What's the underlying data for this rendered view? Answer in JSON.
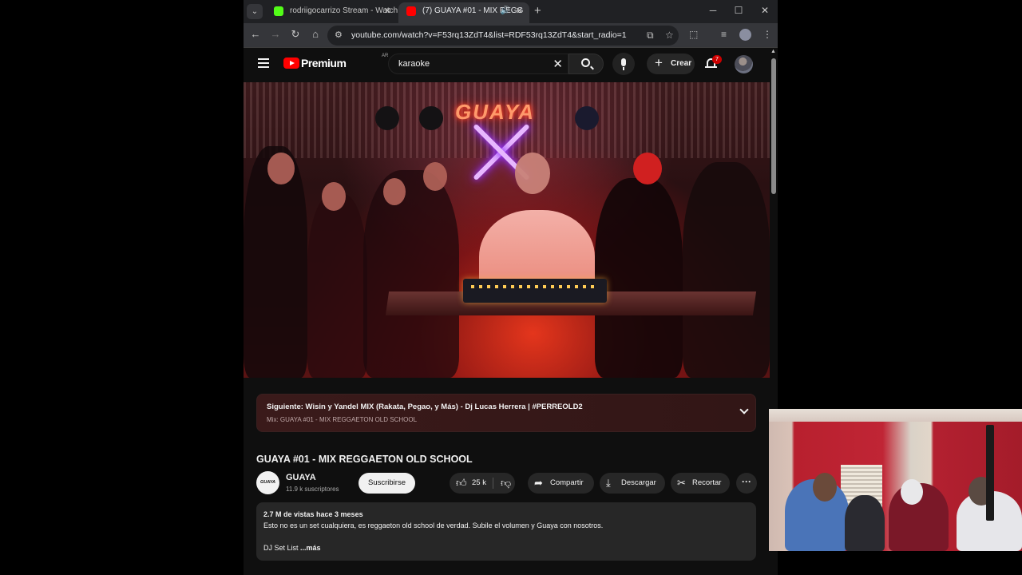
{
  "browser": {
    "tabs": [
      {
        "title": "rodriigocarrizo Stream - Watch",
        "favicon_color": "#53fc18",
        "active": false
      },
      {
        "title": "(7) GUAYA #01 - MIX REGG",
        "favicon_color": "#ff0000",
        "active": true
      }
    ],
    "url": "youtube.com/watch?v=F53rq13ZdT4&list=RDF53rq13ZdT4&start_radio=1"
  },
  "youtube": {
    "logo_text": "Premium",
    "country_code": "AR",
    "search_query": "karaoke",
    "create_label": "Crear",
    "notification_count": "7"
  },
  "upnext": {
    "label": "Siguiente: Wisin y Yandel MIX (Rakata, Pegao, y Más) - Dj Lucas Herrera | #PERREOLD2",
    "mix": "Mix: GUAYA #01 - MIX REGGAETON OLD SCHOOL"
  },
  "video": {
    "neon_sign": "GUAYA",
    "title": "GUAYA #01 - MIX REGGAETON OLD SCHOOL",
    "channel": "GUAYA",
    "channel_avatar_text": "GUAYA",
    "subscribers": "11.9 k suscriptores",
    "subscribe_label": "Suscribirse",
    "likes": "25 k",
    "share_label": "Compartir",
    "download_label": "Descargar",
    "clip_label": "Recortar",
    "views_and_date": "2.7 M de vistas  hace 3 meses",
    "description": "Esto no es un set cualquiera, es reggaeton old school de verdad. Subile el volumen y Guaya con nosotros.",
    "description_line2": "DJ Set List",
    "more_label": "...más"
  },
  "icons": {
    "menu": "hamburger-icon",
    "search": "search-icon",
    "mic": "mic-icon",
    "bell": "bell-icon",
    "like": "thumbs-up-icon",
    "dislike": "thumbs-down-icon",
    "share": "share-icon",
    "download": "download-icon",
    "clip": "scissors-icon",
    "more": "more-horizontal-icon"
  }
}
